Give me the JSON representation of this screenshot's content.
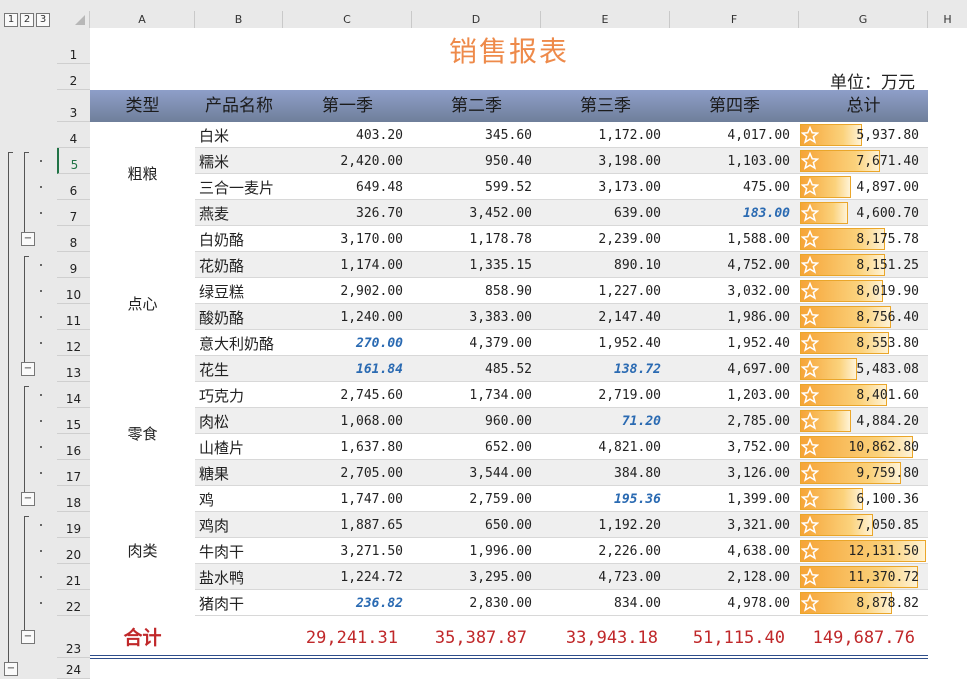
{
  "outline_levels": [
    "1",
    "2",
    "3"
  ],
  "collapse_symbol": "−",
  "columns": [
    "A",
    "B",
    "C",
    "D",
    "E",
    "F",
    "G",
    "H"
  ],
  "row_numbers": [
    "1",
    "2",
    "3",
    "4",
    "5",
    "6",
    "7",
    "8",
    "9",
    "10",
    "11",
    "12",
    "13",
    "14",
    "15",
    "16",
    "17",
    "18",
    "19",
    "20",
    "21",
    "22",
    "23",
    "24"
  ],
  "selected_row": "5",
  "title": "销售报表",
  "unit": "单位：万元",
  "headers": [
    "类型",
    "产品名称",
    "第一季",
    "第二季",
    "第三季",
    "第四季",
    "总计"
  ],
  "categories": [
    {
      "name": "粗粮",
      "first_row": 0,
      "rows": 4
    },
    {
      "name": "点心",
      "first_row": 4,
      "rows": 6
    },
    {
      "name": "零食",
      "first_row": 10,
      "rows": 4
    },
    {
      "name": "肉类",
      "first_row": 14,
      "rows": 5
    }
  ],
  "rows": [
    {
      "product": "白米",
      "q1": "403.20",
      "q2": "345.60",
      "q3": "1,172.00",
      "q4": "4,017.00",
      "total": "5,937.80",
      "total_value": 5937.8
    },
    {
      "product": "糯米",
      "q1": "2,420.00",
      "q2": "950.40",
      "q3": "3,198.00",
      "q4": "1,103.00",
      "total": "7,671.40",
      "total_value": 7671.4
    },
    {
      "product": "三合一麦片",
      "q1": "649.48",
      "q2": "599.52",
      "q3": "3,173.00",
      "q4": "475.00",
      "total": "4,897.00",
      "total_value": 4897.0
    },
    {
      "product": "燕麦",
      "q1": "326.70",
      "q2": "3,452.00",
      "q3": "639.00",
      "q4": "183.00",
      "total": "4,600.70",
      "total_value": 4600.7,
      "low": [
        "q4"
      ]
    },
    {
      "product": "白奶酪",
      "q1": "3,170.00",
      "q2": "1,178.78",
      "q3": "2,239.00",
      "q4": "1,588.00",
      "total": "8,175.78",
      "total_value": 8175.78
    },
    {
      "product": "花奶酪",
      "q1": "1,174.00",
      "q2": "1,335.15",
      "q3": "890.10",
      "q4": "4,752.00",
      "total": "8,151.25",
      "total_value": 8151.25
    },
    {
      "product": "绿豆糕",
      "q1": "2,902.00",
      "q2": "858.90",
      "q3": "1,227.00",
      "q4": "3,032.00",
      "total": "8,019.90",
      "total_value": 8019.9
    },
    {
      "product": "酸奶酪",
      "q1": "1,240.00",
      "q2": "3,383.00",
      "q3": "2,147.40",
      "q4": "1,986.00",
      "total": "8,756.40",
      "total_value": 8756.4
    },
    {
      "product": "意大利奶酪",
      "q1": "270.00",
      "q2": "4,379.00",
      "q3": "1,952.40",
      "q4": "1,952.40",
      "total": "8,553.80",
      "total_value": 8553.8,
      "low": [
        "q1"
      ]
    },
    {
      "product": "花生",
      "q1": "161.84",
      "q2": "485.52",
      "q3": "138.72",
      "q4": "4,697.00",
      "total": "5,483.08",
      "total_value": 5483.08,
      "low": [
        "q1",
        "q3"
      ]
    },
    {
      "product": "巧克力",
      "q1": "2,745.60",
      "q2": "1,734.00",
      "q3": "2,719.00",
      "q4": "1,203.00",
      "total": "8,401.60",
      "total_value": 8401.6
    },
    {
      "product": "肉松",
      "q1": "1,068.00",
      "q2": "960.00",
      "q3": "71.20",
      "q4": "2,785.00",
      "total": "4,884.20",
      "total_value": 4884.2,
      "low": [
        "q3"
      ]
    },
    {
      "product": "山楂片",
      "q1": "1,637.80",
      "q2": "652.00",
      "q3": "4,821.00",
      "q4": "3,752.00",
      "total": "10,862.80",
      "total_value": 10862.8
    },
    {
      "product": "糖果",
      "q1": "2,705.00",
      "q2": "3,544.00",
      "q3": "384.80",
      "q4": "3,126.00",
      "total": "9,759.80",
      "total_value": 9759.8
    },
    {
      "product": "鸡",
      "q1": "1,747.00",
      "q2": "2,759.00",
      "q3": "195.36",
      "q4": "1,399.00",
      "total": "6,100.36",
      "total_value": 6100.36,
      "low": [
        "q3"
      ]
    },
    {
      "product": "鸡肉",
      "q1": "1,887.65",
      "q2": "650.00",
      "q3": "1,192.20",
      "q4": "3,321.00",
      "total": "7,050.85",
      "total_value": 7050.85
    },
    {
      "product": "牛肉干",
      "q1": "3,271.50",
      "q2": "1,996.00",
      "q3": "2,226.00",
      "q4": "4,638.00",
      "total": "12,131.50",
      "total_value": 12131.5
    },
    {
      "product": "盐水鸭",
      "q1": "1,224.72",
      "q2": "3,295.00",
      "q3": "4,723.00",
      "q4": "2,128.00",
      "total": "11,370.72",
      "total_value": 11370.72
    },
    {
      "product": "猪肉干",
      "q1": "236.82",
      "q2": "2,830.00",
      "q3": "834.00",
      "q4": "4,978.00",
      "total": "8,878.82",
      "total_value": 8878.82,
      "low": [
        "q1"
      ]
    }
  ],
  "databar_max": 12131.5,
  "totals": {
    "label": "合计",
    "q1": "29,241.31",
    "q2": "35,387.87",
    "q3": "33,943.18",
    "q4": "51,115.40",
    "total": "149,687.76"
  },
  "colors": {
    "title": "#ee8a4a",
    "header_band": "#7d8eb3",
    "total_text": "#c0282a",
    "low_value": "#2a6ab2",
    "databar": "#f6a437"
  }
}
